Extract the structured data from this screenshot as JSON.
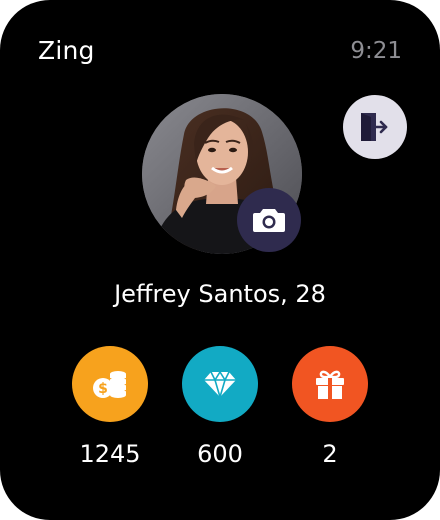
{
  "app": {
    "title": "Zing"
  },
  "status": {
    "time": "9:21"
  },
  "profile": {
    "name": "Jeffrey Santos, 28",
    "avatar_icon": "user-photo",
    "camera_icon": "camera-icon",
    "logout_icon": "logout-icon"
  },
  "stats": {
    "coins": {
      "value": "1245",
      "icon": "coins-dollar-icon",
      "color": "#f7a21d"
    },
    "gems": {
      "value": "600",
      "icon": "diamond-icon",
      "color": "#12aac4"
    },
    "gifts": {
      "value": "2",
      "icon": "gift-icon",
      "color": "#f15522"
    }
  },
  "colors": {
    "background": "#000000",
    "camera_button": "#2f2b4e",
    "logout_button": "#e2e0ea",
    "clock_text": "#8e8e93"
  }
}
